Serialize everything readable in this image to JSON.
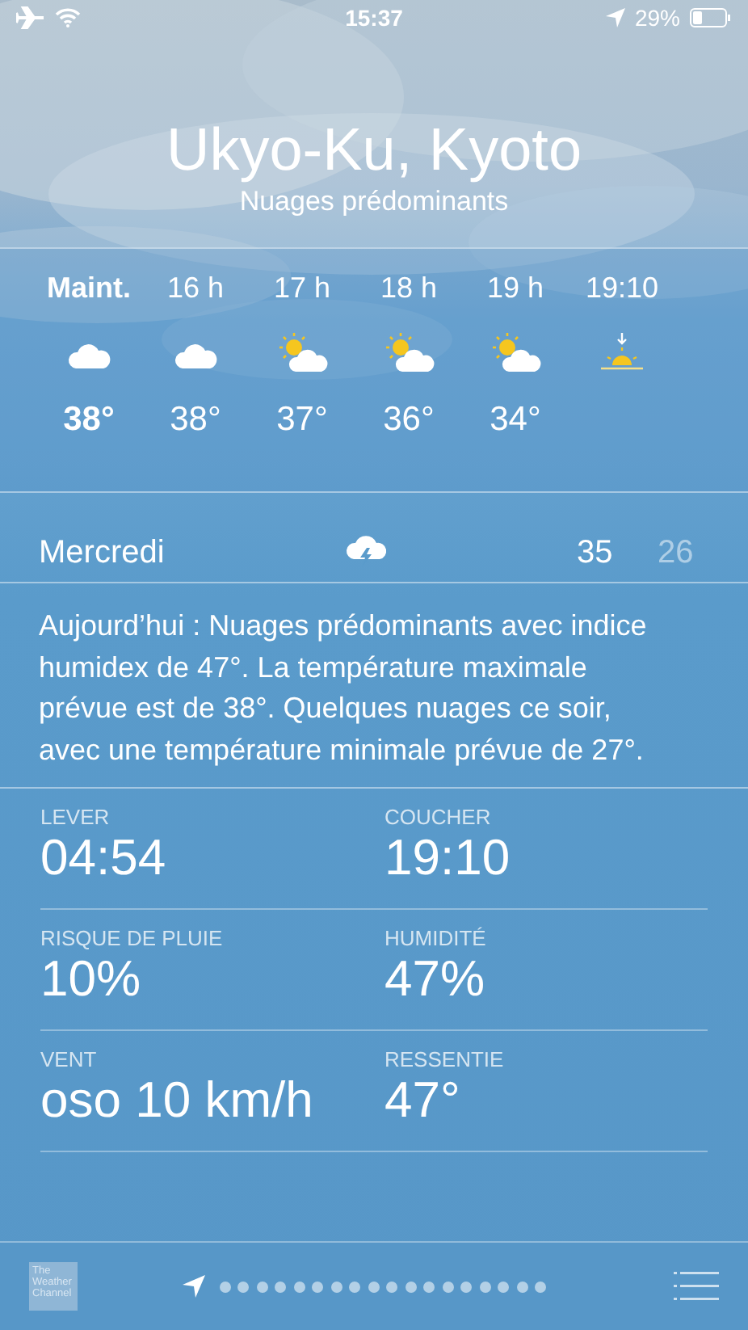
{
  "status_bar": {
    "time": "15:37",
    "battery": "29%"
  },
  "header": {
    "city": "Ukyo-Ku, Kyoto",
    "condition": "Nuages prédominants"
  },
  "hourly": [
    {
      "time": "Maint.",
      "kind": "cloud",
      "temp": "38°",
      "selected": true
    },
    {
      "time": "16 h",
      "kind": "cloud",
      "temp": "38°",
      "selected": false
    },
    {
      "time": "17 h",
      "kind": "suncloud",
      "temp": "37°",
      "selected": false
    },
    {
      "time": "18 h",
      "kind": "suncloud",
      "temp": "36°",
      "selected": false
    },
    {
      "time": "19 h",
      "kind": "suncloud",
      "temp": "34°",
      "selected": false
    },
    {
      "time": "19:10",
      "kind": "sunset",
      "selected": false
    }
  ],
  "daily": [
    {
      "day": "Mercredi",
      "kind": "thunder",
      "high": "35",
      "low": "26"
    }
  ],
  "summary": "Aujourd’hui : Nuages prédominants avec indice humidex de 47°. La température maximale prévue est de 38°. Quelques nuages ce soir, avec une température minimale prévue de 27°.",
  "details": [
    {
      "label": "LEVER",
      "value": "04:54"
    },
    {
      "label": "COUCHER",
      "value": "19:10"
    },
    {
      "label": "RISQUE DE PLUIE",
      "value": "10%"
    },
    {
      "label": "HUMIDITÉ",
      "value": "47%"
    },
    {
      "label": "VENT",
      "value": "oso 10 km/h"
    },
    {
      "label": "RESSENTIE",
      "value": "47°"
    }
  ],
  "bottom_bar": {
    "logo": "The Weather Channel",
    "pages": [
      {
        "kind": "location",
        "selected": true
      },
      {
        "kind": "dot",
        "selected": false
      },
      {
        "kind": "dot",
        "selected": false
      },
      {
        "kind": "dot",
        "selected": false
      },
      {
        "kind": "dot",
        "selected": false
      },
      {
        "kind": "dot",
        "selected": false
      },
      {
        "kind": "dot",
        "selected": false
      },
      {
        "kind": "dot",
        "selected": false
      },
      {
        "kind": "dot",
        "selected": false
      },
      {
        "kind": "dot",
        "selected": false
      },
      {
        "kind": "dot",
        "selected": false
      },
      {
        "kind": "dot",
        "selected": false
      },
      {
        "kind": "dot",
        "selected": false
      },
      {
        "kind": "dot",
        "selected": false
      },
      {
        "kind": "dot",
        "selected": false
      },
      {
        "kind": "dot",
        "selected": false
      },
      {
        "kind": "dot",
        "selected": false
      },
      {
        "kind": "dot",
        "selected": false
      },
      {
        "kind": "dot",
        "selected": false
      }
    ]
  }
}
